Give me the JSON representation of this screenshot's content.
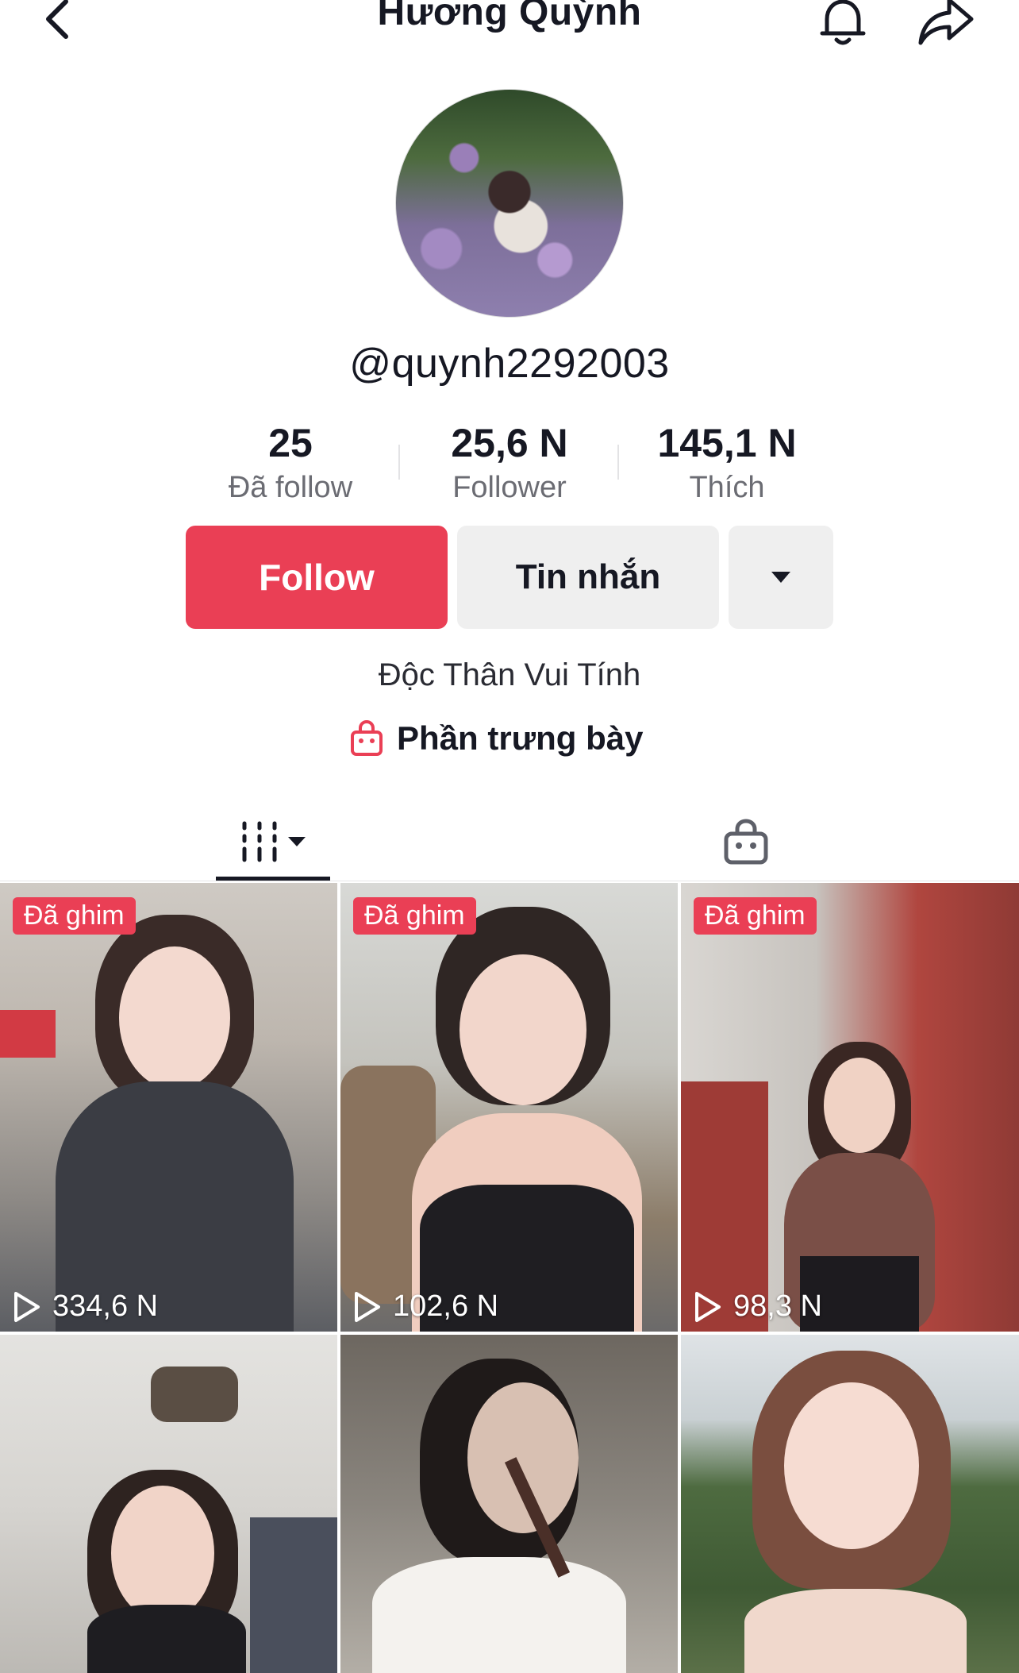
{
  "header": {
    "title": "Hương Quỳnh"
  },
  "profile": {
    "username": "@quynh2292003",
    "bio": "Độc Thân Vui Tính",
    "showcase_label": "Phần trưng bày"
  },
  "stats": [
    {
      "value": "25",
      "label": "Đã follow"
    },
    {
      "value": "25,6 N",
      "label": "Follower"
    },
    {
      "value": "145,1 N",
      "label": "Thích"
    }
  ],
  "actions": {
    "follow_label": "Follow",
    "message_label": "Tin nhắn"
  },
  "colors": {
    "accent": "#ea3f55",
    "button_gray": "#efefef"
  },
  "videos": [
    {
      "pinned_label": "Đã ghim",
      "views": "334,6 N"
    },
    {
      "pinned_label": "Đã ghim",
      "views": "102,6 N"
    },
    {
      "pinned_label": "Đã ghim",
      "views": "98,3 N"
    },
    {
      "pinned_label": "",
      "views": ""
    },
    {
      "pinned_label": "",
      "views": ""
    },
    {
      "pinned_label": "",
      "views": ""
    }
  ]
}
